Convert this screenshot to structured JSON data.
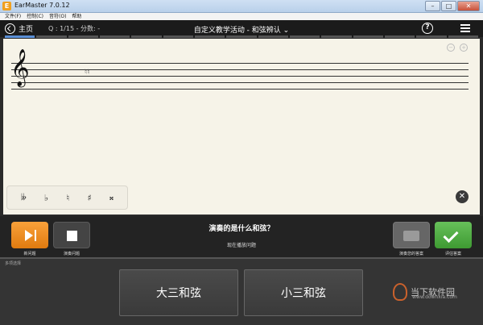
{
  "window": {
    "title": "EarMaster 7.0.12",
    "app_icon": "E"
  },
  "menubar": {
    "items": [
      "文件(F)",
      "控制(C)",
      "音符(O)",
      "帮助"
    ]
  },
  "header": {
    "home_label": "主页",
    "question_score": "Q : 1/15 - 分数: -",
    "title": "自定义教学活动 - 和弦辨认 ⌄",
    "help_icon_glyph": "?"
  },
  "progress": {
    "total_segments": 15,
    "current": 1
  },
  "staff": {
    "clef": "𝄞",
    "chord": "♮♮"
  },
  "accidentals": [
    "𝄫",
    "♭",
    "♮",
    "♯",
    "𝄪"
  ],
  "controls": {
    "new_question_label": "新问题",
    "play_question_label": "演奏问题",
    "question_text": "演奏的是什么和弦？",
    "status_text": "现在播放问题",
    "replay_label": "演奏您的答案",
    "assess_label": "评估答案"
  },
  "answers": {
    "header": "多项选择",
    "options": [
      "大三和弦",
      "小三和弦"
    ]
  },
  "watermark": {
    "text": "当下软件园",
    "url": "www.downxia.com"
  },
  "colors": {
    "accent_orange": "#F08A1E",
    "accent_green": "#4CAF3E",
    "progress_blue": "#5A8FD6"
  }
}
